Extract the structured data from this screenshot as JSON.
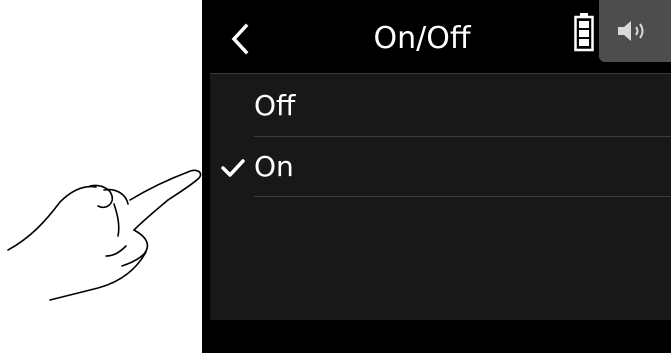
{
  "header": {
    "title": "On/Off"
  },
  "icons": {
    "back": "chevron-left-icon",
    "battery": "battery-icon",
    "speaker": "speaker-icon",
    "check": "checkmark-icon",
    "hand": "pointing-hand-illustration"
  },
  "options": [
    {
      "label": "Off",
      "selected": false
    },
    {
      "label": "On",
      "selected": true
    }
  ],
  "colors": {
    "screen_bg": "#000000",
    "list_bg": "#181818",
    "speaker_button_bg": "#4d4d4d",
    "text": "#ffffff",
    "divider": "#3c3c3c"
  }
}
